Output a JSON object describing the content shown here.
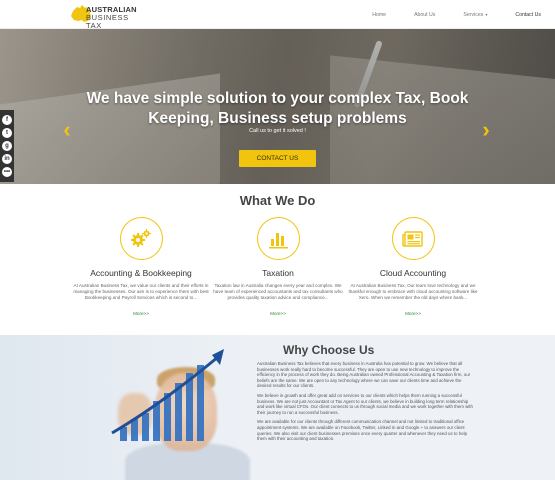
{
  "brand": {
    "line1": "AUSTRALIAN",
    "line2": "BUSINESS TAX",
    "accent_color": "#f1c40f"
  },
  "nav": {
    "items": [
      {
        "label": "Home"
      },
      {
        "label": "About Us"
      },
      {
        "label": "Services"
      },
      {
        "label": "Contact Us"
      }
    ]
  },
  "hero": {
    "title": "We have simple solution to your complex Tax, Book Keeping, Business setup problems",
    "subtitle": "Call us to get it solved !",
    "cta_label": "CONTACT US",
    "prev_icon": "chevron-left-icon",
    "next_icon": "chevron-right-icon"
  },
  "social": [
    {
      "icon": "facebook-icon",
      "glyph": "f"
    },
    {
      "icon": "twitter-icon",
      "glyph": "t"
    },
    {
      "icon": "google-plus-icon",
      "glyph": "g"
    },
    {
      "icon": "linkedin-icon",
      "glyph": "in"
    },
    {
      "icon": "more-icon",
      "glyph": "•••"
    }
  ],
  "what_we_do": {
    "title": "What We Do",
    "services": [
      {
        "icon": "gears-icon",
        "title": "Accounting & Bookkeeping",
        "text": "At Australian Business Tax, we value our clients and their efforts in managing the businesses. Our aim is to experience them with best Bookkeeping and Payroll Services which is second to...",
        "more": "More>>"
      },
      {
        "icon": "bar-chart-icon",
        "title": "Taxation",
        "text": "Taxation law in Australia changes every year and complex. We have team of experienced accountants and tax consultants who provides quality taxation advice and compliance...",
        "more": "More>>"
      },
      {
        "icon": "newspaper-icon",
        "title": "Cloud Accounting",
        "text": "At Australian Business Tax, Our team love technology and we thankful enough to embrace with cloud accounting software like Xero. When we remember the old days where bank...",
        "more": "More>>"
      }
    ]
  },
  "why_choose_us": {
    "title": "Why Choose Us",
    "paragraphs": [
      "Australian Business Tax believes that every business in Australia has potential to grow. We believe that all businesses work really hard to become successful. They are open to use new technology to improve the efficiency in the process of work they do. Being Australian owned Professional Accounting & Taxation firm, our beliefs are the same. We are open to any technology where we can save our clients time and achieve the desired results for our clients.",
      "We believe in growth and offer great add on services to our clients which helps them running a successful business. We are not just Accountant or Tax Agent to our clients, we believe in building long term relationship and work like virtual CFOs. Our client connects to us through social media and we work together with them with their journey to run a successful business.",
      "We are available for our clients through different communication channel and not limited to traditional office appointment systems. We are available on Facebook, Twitter, Linked In and Google + to answers our client queries. We also visit our client businesses premises once every quarter and whenever they need us to help them with their accounting and taxation."
    ]
  }
}
